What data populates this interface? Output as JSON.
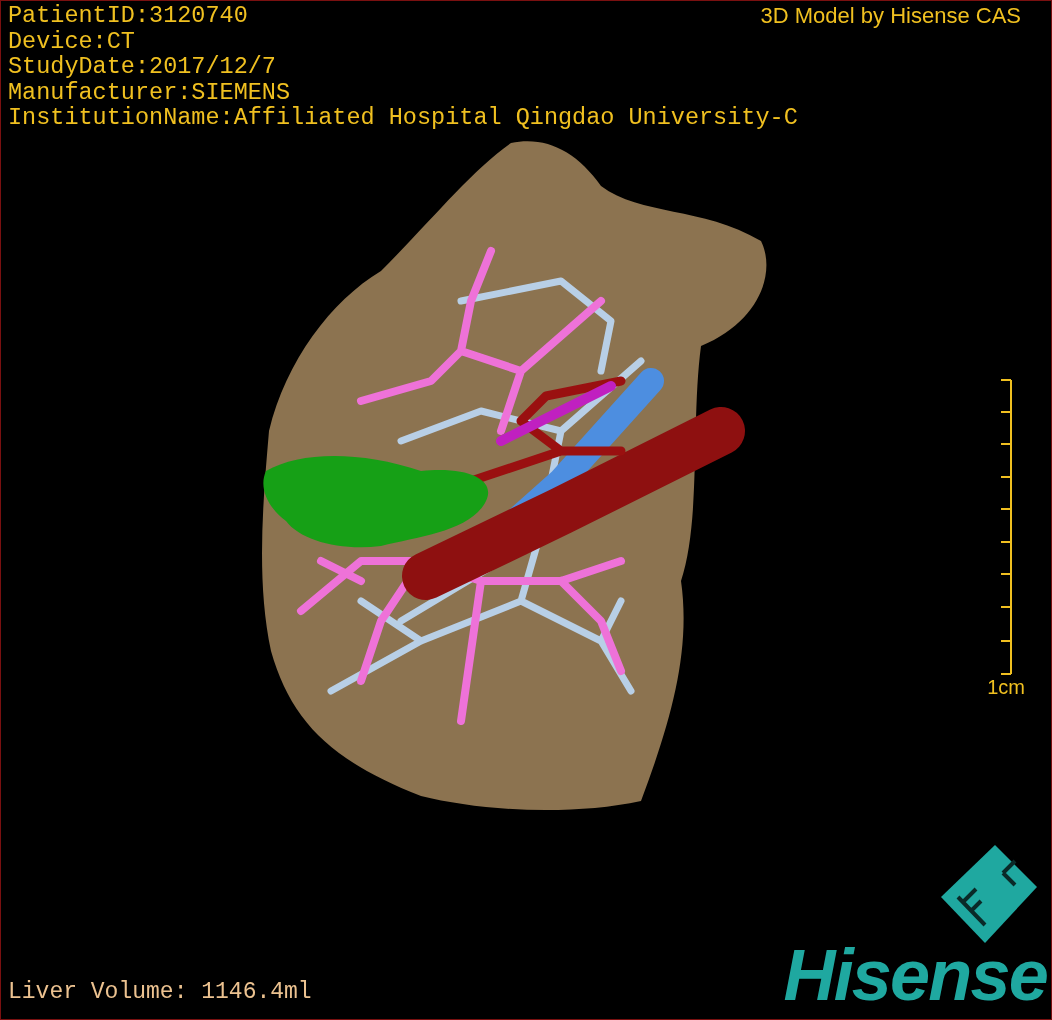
{
  "patient_info": [
    "PatientID:3120740",
    "Device:CT",
    "StudyDate:2017/12/7",
    "Manufacturer:SIEMENS",
    "InstitutionName:Affiliated Hospital Qingdao University-C"
  ],
  "credit": "3D Model by Hisense CAS",
  "scale": {
    "label": "1cm"
  },
  "liver_volume": "Liver Volume: 1146.4ml",
  "logo": {
    "text": "Hisense"
  }
}
